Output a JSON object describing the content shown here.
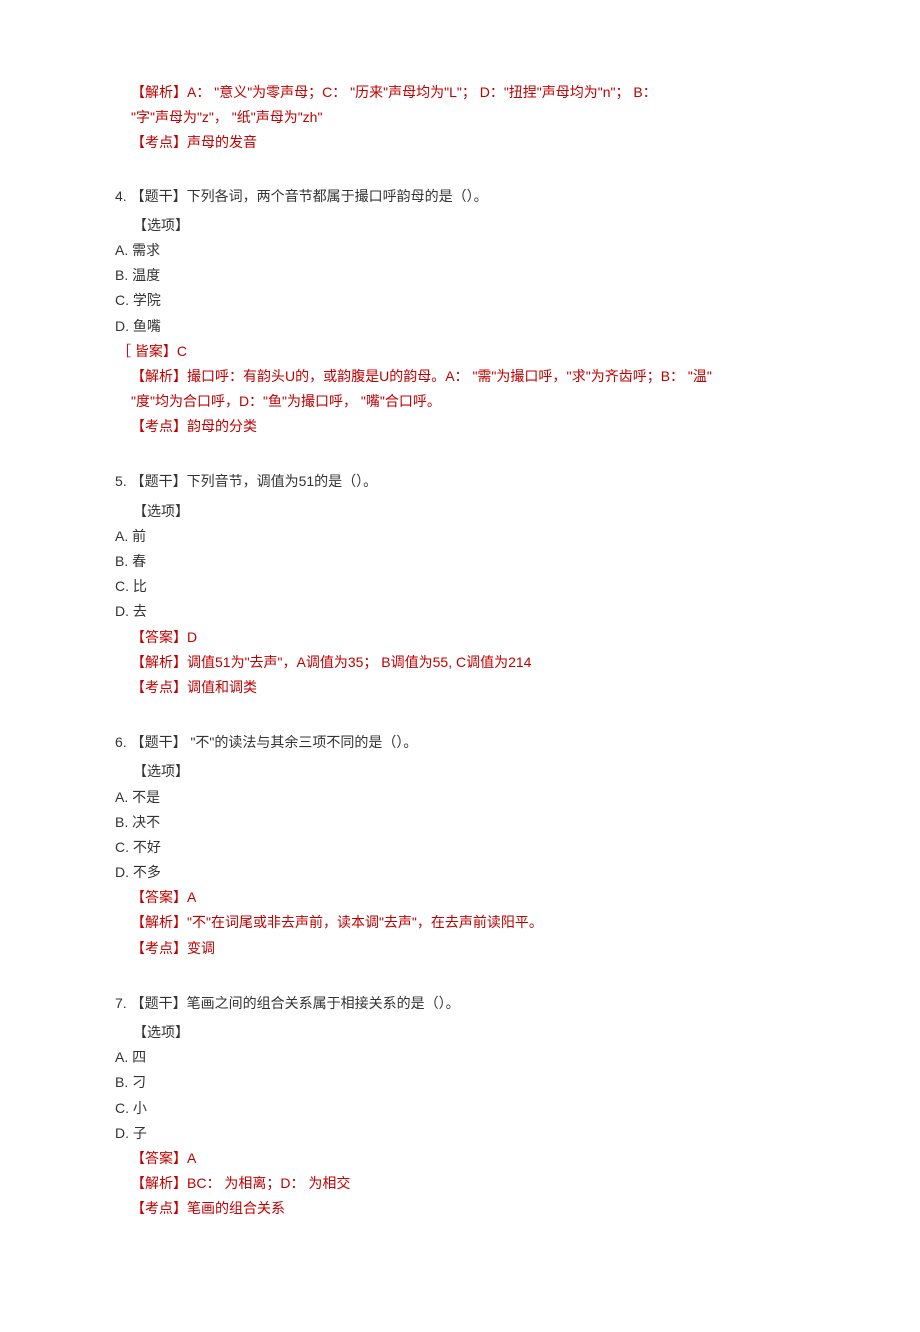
{
  "intro_analysis": {
    "explain_line1_prefix": "【解析】A： ",
    "explain_line1_rest": "\"意义\"为零声母；C：  \"历来\"声母均为\"L\"；  D：\"扭捏\"声母均为\"n\"；  B：",
    "explain_line2": "\"字\"声母为\"z\"， \"纸\"声母为\"zh\"",
    "kaodian_prefix": "【考点】",
    "kaodian_text": "声母的发音"
  },
  "q4": {
    "num": "4.",
    "stem": "    【题干】下列各词，两个音节都属于撮口呼韵母的是（）。",
    "options_label": "【选项】",
    "A": "A.   需求",
    "B": "B.   温度",
    "C": "C.   学院",
    "D": "D.   鱼嘴",
    "answer_prefix": "［ 皆案】",
    "answer_val": "C",
    "explain_prefix": "【解析】",
    "explain_text1": "撮口呼：有韵头U的，或韵腹是U的韵母。A：  \"需\"为撮口呼，''求\"为齐齿呼；B：  \"温\"",
    "explain_text2": "\"度\"均为合口呼，D：\"鱼\"为撮口呼， \"嘴\"合口呼。",
    "kaodian_prefix": "【考点】",
    "kaodian_text": "韵母的分类"
  },
  "q5": {
    "num": "5.",
    "stem": " 【题干】下列音节，调值为51的是（）。",
    "options_label": "【选项】",
    "A": "A.    前",
    "B": "B.   春",
    "C": "C.    比",
    "D": "D.    去",
    "answer_prefix": "【答案】",
    "answer_val": "D",
    "explain_prefix": "【解析】",
    "explain_text": "调值51为\"去声\"，A调值为35；  B调值为55, C调值为214",
    "kaodian_prefix": "【考点】",
    "kaodian_text": "调值和调类"
  },
  "q6": {
    "num": "6.",
    "stem": " 【题干】 \"不\"的读法与其余三项不同的是（）。",
    "options_label": "【选项】",
    "A": "A.   不是",
    "B": "B.   决不",
    "C": "C.   不好",
    "D": "D.   不多",
    "answer_prefix": "【答案】",
    "answer_val": "A",
    "explain_prefix": "【解析】",
    "explain_text": "\"不\"在词尾或非去声前，读本调\"去声\"，在去声前读阳平。",
    "kaodian_prefix": "【考点】",
    "kaodian_text": "变调"
  },
  "q7": {
    "num": "7.",
    "stem": " 【题干】笔画之间的组合关系属于相接关系的是（）。",
    "options_label": "【选项】",
    "A": "A.    四",
    "B": "B.   刁",
    "C": "C.    小",
    "D": "D.    子",
    "answer_prefix": "【答案】",
    "answer_val": "A",
    "explain_prefix": "【解析】",
    "explain_text": "BC：  为相离；D：  为相交",
    "kaodian_prefix": "【考点】",
    "kaodian_text": "笔画的组合关系"
  }
}
